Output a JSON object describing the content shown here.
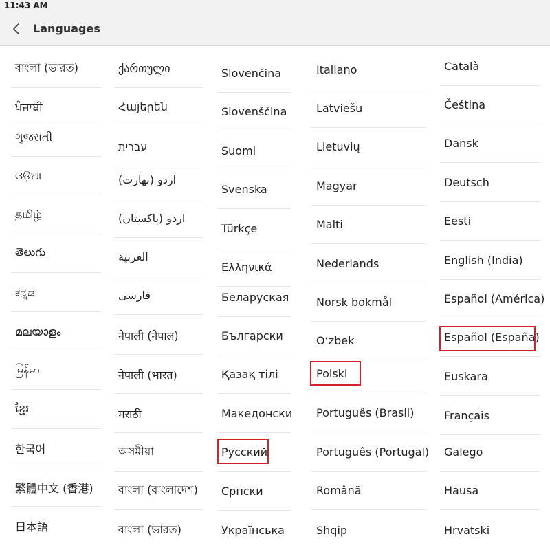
{
  "status_bar": {
    "time": "11:43 AM"
  },
  "header": {
    "title": "Languages",
    "back_icon": "chevron-left-icon"
  },
  "highlight_color": "#d32026",
  "columns": [
    [
      "বাংলা (ভারত)",
      "ਪੰਜਾਬੀ",
      "ગુજરાતી",
      "ଓଡ଼ିଆ",
      "தமிழ்",
      "తెలుగు",
      "ಕನ್ನಡ",
      "മലയാളം",
      "မြန်မာ",
      "ខ្មែរ",
      "한국어",
      "繁體中文 (香港)",
      "日本語"
    ],
    [
      "ქართული",
      "Հայերեն",
      "עברית",
      "اردو (بھارت)",
      "اردو (پاکستان)",
      "العربية",
      "فارسی",
      "नेपाली (नेपाल)",
      "नेपाली (भारत)",
      "मराठी",
      "অসমীয়া",
      "বাংলা (বাংলাদেশ)",
      "বাংলা (ভারত)"
    ],
    [
      "Slovenčina",
      "Slovenščina",
      "Suomi",
      "Svenska",
      "Türkçe",
      "Ελληνικά",
      "Беларуская",
      "Български",
      "Қазақ тілі",
      "Македонски",
      "Русский",
      "Српски",
      "Українська"
    ],
    [
      "Italiano",
      "Latviešu",
      "Lietuvių",
      "Magyar",
      "Malti",
      "Nederlands",
      "Norsk bokmål",
      "O‘zbek",
      "Polski",
      "Português (Brasil)",
      "Português (Portugal)",
      "Română",
      "Shqip"
    ],
    [
      "Català",
      "Čeština",
      "Dansk",
      "Deutsch",
      "Eesti",
      "English (India)",
      "Español (América)",
      "Español (España)",
      "Euskara",
      "Français",
      "Galego",
      "Hausa",
      "Hrvatski"
    ]
  ]
}
